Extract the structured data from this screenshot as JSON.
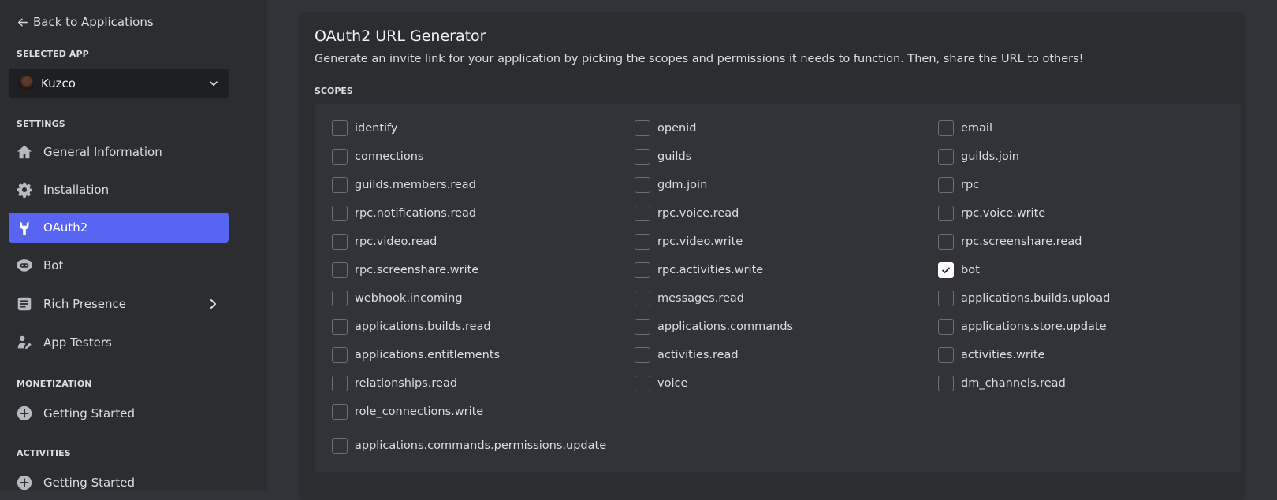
{
  "sidebar": {
    "back_label": "Back to Applications",
    "selected_app_header": "SELECTED APP",
    "app_name": "Kuzco",
    "settings_header": "SETTINGS",
    "settings_items": [
      {
        "label": "General Information",
        "icon": "home-icon"
      },
      {
        "label": "Installation",
        "icon": "gear-icon"
      },
      {
        "label": "OAuth2",
        "icon": "wrench-icon",
        "active": true
      },
      {
        "label": "Bot",
        "icon": "bot-icon"
      },
      {
        "label": "Rich Presence",
        "icon": "rich-presence-icon",
        "has_submenu": true
      },
      {
        "label": "App Testers",
        "icon": "app-testers-icon"
      }
    ],
    "monetization_header": "MONETIZATION",
    "monetization_items": [
      {
        "label": "Getting Started",
        "icon": "plus-circle-icon"
      }
    ],
    "activities_header": "ACTIVITIES",
    "activities_items": [
      {
        "label": "Getting Started",
        "icon": "plus-circle-icon"
      }
    ]
  },
  "main": {
    "title": "OAuth2 URL Generator",
    "description": "Generate an invite link for your application by picking the scopes and permissions it needs to function. Then, share the URL to others!",
    "scopes_header": "SCOPES",
    "scopes": [
      {
        "label": "identify",
        "checked": false
      },
      {
        "label": "openid",
        "checked": false
      },
      {
        "label": "email",
        "checked": false
      },
      {
        "label": "connections",
        "checked": false
      },
      {
        "label": "guilds",
        "checked": false
      },
      {
        "label": "guilds.join",
        "checked": false
      },
      {
        "label": "guilds.members.read",
        "checked": false
      },
      {
        "label": "gdm.join",
        "checked": false
      },
      {
        "label": "rpc",
        "checked": false
      },
      {
        "label": "rpc.notifications.read",
        "checked": false
      },
      {
        "label": "rpc.voice.read",
        "checked": false
      },
      {
        "label": "rpc.voice.write",
        "checked": false
      },
      {
        "label": "rpc.video.read",
        "checked": false
      },
      {
        "label": "rpc.video.write",
        "checked": false
      },
      {
        "label": "rpc.screenshare.read",
        "checked": false
      },
      {
        "label": "rpc.screenshare.write",
        "checked": false
      },
      {
        "label": "rpc.activities.write",
        "checked": false
      },
      {
        "label": "bot",
        "checked": true
      },
      {
        "label": "webhook.incoming",
        "checked": false
      },
      {
        "label": "messages.read",
        "checked": false
      },
      {
        "label": "applications.builds.upload",
        "checked": false
      },
      {
        "label": "applications.builds.read",
        "checked": false
      },
      {
        "label": "applications.commands",
        "checked": false
      },
      {
        "label": "applications.store.update",
        "checked": false
      },
      {
        "label": "applications.entitlements",
        "checked": false
      },
      {
        "label": "activities.read",
        "checked": false
      },
      {
        "label": "activities.write",
        "checked": false
      },
      {
        "label": "relationships.read",
        "checked": false
      },
      {
        "label": "voice",
        "checked": false
      },
      {
        "label": "dm_channels.read",
        "checked": false
      },
      {
        "label": "role_connections.write",
        "checked": false
      },
      {
        "label": "applications.commands.permissions.update",
        "checked": false
      }
    ]
  },
  "colors": {
    "accent": "#5865f2",
    "sidebar_bg": "#2b2d31",
    "page_bg": "#313338",
    "input_bg": "#1e1f22"
  }
}
